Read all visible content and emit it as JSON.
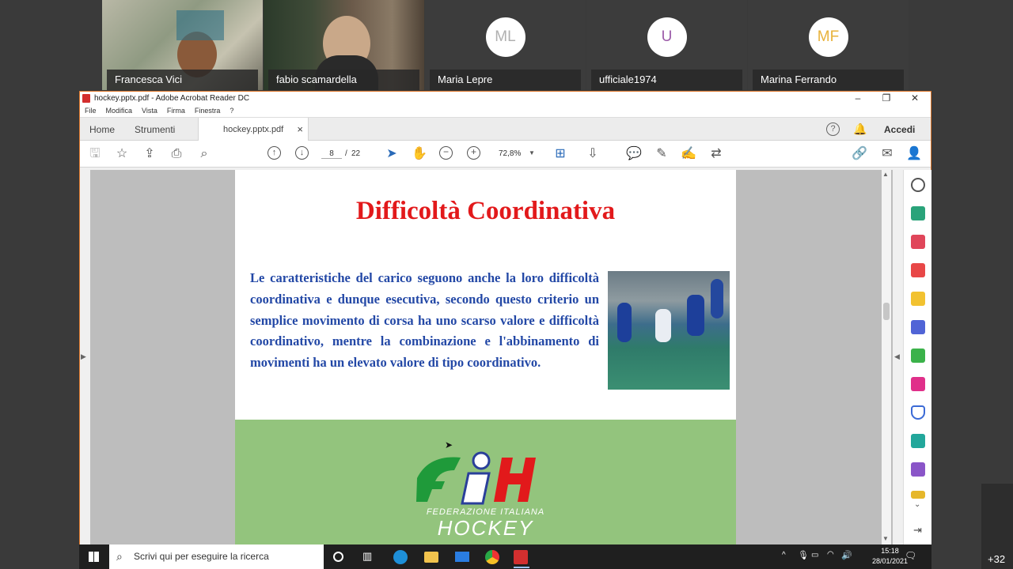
{
  "participants": [
    {
      "name": "Francesca Vici",
      "type": "video"
    },
    {
      "name": "fabio scamardella",
      "type": "video"
    },
    {
      "name": "Maria Lepre",
      "initials": "ML",
      "initials_color": "#b0b0b0"
    },
    {
      "name": "ufficiale1974",
      "initials": "U",
      "initials_color": "#9c5ba8"
    },
    {
      "name": "Marina Ferrando",
      "initials": "MF",
      "initials_color": "#e8b23a"
    }
  ],
  "window": {
    "title": "hockey.pptx.pdf - Adobe Acrobat Reader DC",
    "minimize": "–",
    "restore": "❐",
    "close": "✕"
  },
  "menu": [
    "File",
    "Modifica",
    "Vista",
    "Firma",
    "Finestra",
    "?"
  ],
  "tabs": {
    "home": "Home",
    "tools": "Strumenti",
    "document": "hockey.pptx.pdf",
    "close": "×",
    "signin": "Accedi"
  },
  "toolbar": {
    "page_current": "8",
    "page_sep": "/",
    "page_total": "22",
    "zoom": "72,8%"
  },
  "slide": {
    "title": "Difficoltà Coordinativa",
    "body": "Le caratteristiche del carico seguono anche la loro difficoltà coordinativa e dunque esecutiva, secondo questo criterio un semplice movimento di corsa ha uno scarso valore e difficoltà coordinativo, mentre la combinazione e l'abbinamento di movimenti ha un elevato valore di tipo coordinativo.",
    "logo_line1": "FEDERAZIONE ITALIANA",
    "logo_line2": "HOCKEY"
  },
  "taskbar": {
    "search_placeholder": "Scrivi qui per eseguire la ricerca",
    "time": "15:18",
    "date": "28/01/2021"
  },
  "overflow_count": "+32",
  "colors": {
    "slide_title": "#e2191b",
    "slide_body": "#2348a6",
    "slide_green": "#93c47d",
    "window_border": "#e0792d"
  }
}
